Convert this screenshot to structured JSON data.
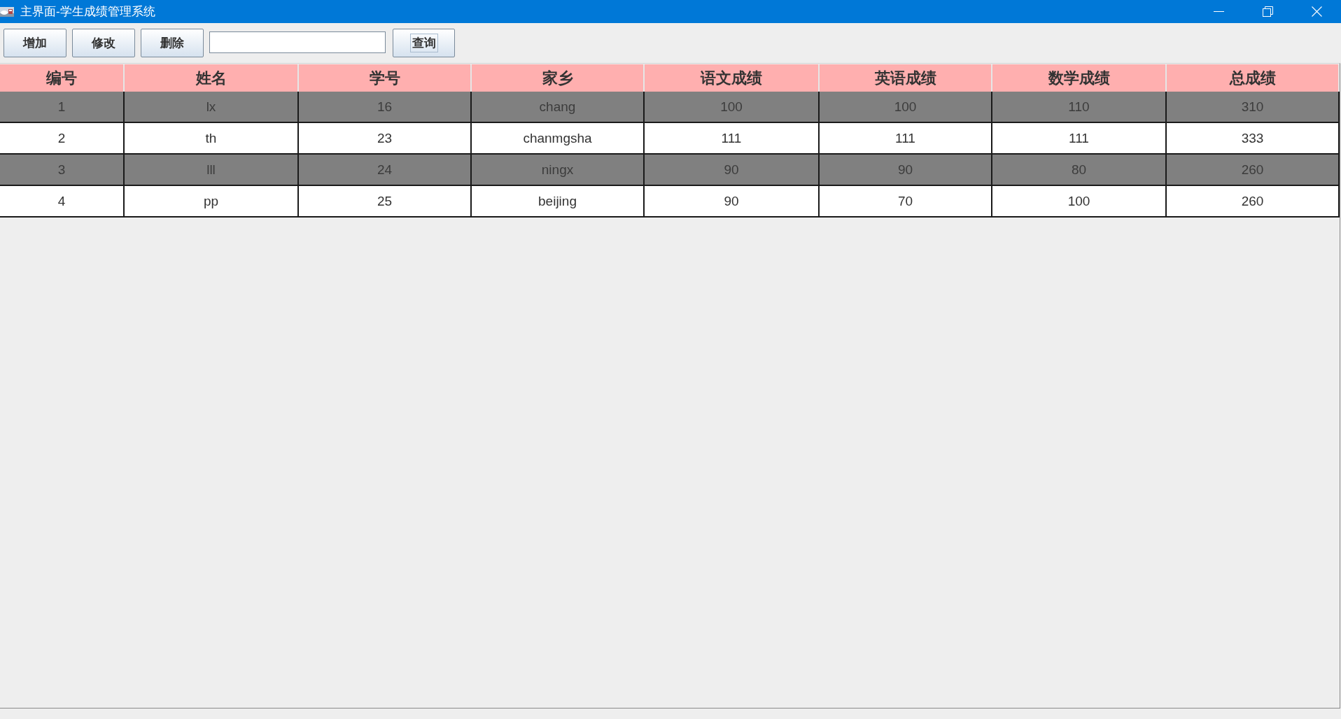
{
  "window": {
    "title": "主界面-学生成绩管理系统"
  },
  "toolbar": {
    "buttons": [
      {
        "label": "增加"
      },
      {
        "label": "修改"
      },
      {
        "label": "删除"
      }
    ],
    "query_button": {
      "label": "查询",
      "focused": true
    }
  },
  "table": {
    "columns": [
      "编号",
      "姓名",
      "学号",
      "家乡",
      "语文成绩",
      "英语成绩",
      "数学成绩",
      "总成绩"
    ],
    "rows": [
      {
        "selected": true,
        "cells": [
          "1",
          "lx",
          "16",
          "chang",
          "100",
          "100",
          "110",
          "310"
        ]
      },
      {
        "selected": false,
        "cells": [
          "2",
          "th",
          "23",
          "chanmgsha",
          "111",
          "111",
          "111",
          "333"
        ]
      },
      {
        "selected": true,
        "cells": [
          "3",
          "lll",
          "24",
          "ningx",
          "90",
          "90",
          "80",
          "260"
        ]
      },
      {
        "selected": false,
        "cells": [
          "4",
          "pp",
          "25",
          "beijing",
          "90",
          "70",
          "100",
          "260"
        ]
      }
    ]
  }
}
